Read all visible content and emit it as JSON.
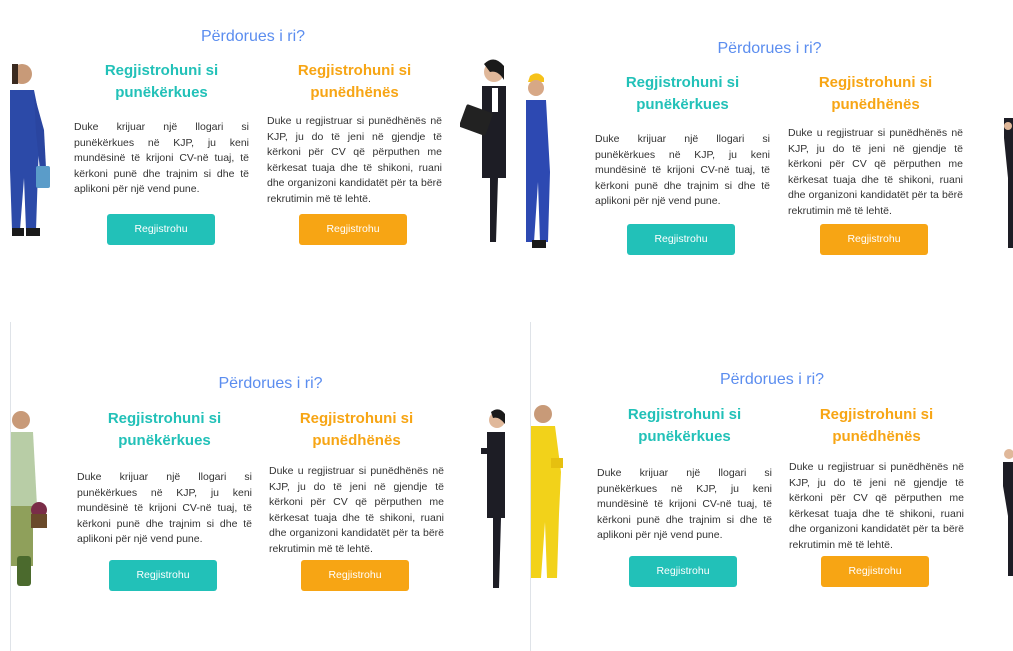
{
  "colors": {
    "title": "#5b8def",
    "jobseeker": "#22c1b8",
    "employer": "#f7a514",
    "text": "#333333"
  },
  "panels": [
    {
      "title": "Përdorues i ri?",
      "jobseeker": {
        "heading_line1": "Regjistrohuni si",
        "heading_line2": "punëkërkues",
        "description": "Duke krijuar një llogari si punëkërkues në KJP, ju keni mundësinë të krijoni CV-në tuaj, të kërkoni punë dhe trajnim si dhe të aplikoni për një vend pune.",
        "button": "Regjistrohu"
      },
      "employer": {
        "heading_line1": "Regjistrohuni si",
        "heading_line2": "punëdhënës",
        "description": "Duke u regjistruar si punëdhënës në KJP, ju do të jeni në gjendje të kërkoni për CV që përputhen me kërkesat tuaja dhe të shikoni, ruani dhe organizoni kandidatët për ta bërë rekrutimin më të lehtë.",
        "button": "Regjistrohu"
      }
    },
    {
      "title": "Përdorues i ri?",
      "jobseeker": {
        "heading_line1": "Regjistrohuni si",
        "heading_line2": "punëkërkues",
        "description": "Duke krijuar një llogari si punëkërkues në KJP, ju keni mundësinë të krijoni CV-në tuaj, të kërkoni punë dhe trajnim si dhe të aplikoni për një vend pune.",
        "button": "Regjistrohu"
      },
      "employer": {
        "heading_line1": "Regjistrohuni si",
        "heading_line2": "punëdhënës",
        "description": "Duke u regjistruar si punëdhënës në KJP, ju do të jeni në gjendje të kërkoni për CV që përputhen me kërkesat tuaja dhe të shikoni, ruani dhe organizoni kandidatët për ta bërë rekrutimin më të lehtë.",
        "button": "Regjistrohu"
      }
    },
    {
      "title": "Përdorues i ri?",
      "jobseeker": {
        "heading_line1": "Regjistrohuni si",
        "heading_line2": "punëkërkues",
        "description": "Duke krijuar një llogari si punëkërkues në KJP, ju keni mundësinë të krijoni CV-në tuaj, të kërkoni punë dhe trajnim si dhe të aplikoni për një vend pune.",
        "button": "Regjistrohu"
      },
      "employer": {
        "heading_line1": "Regjistrohuni si",
        "heading_line2": "punëdhënës",
        "description": "Duke u regjistruar si punëdhënës në KJP, ju do të jeni në gjendje të kërkoni për CV që përputhen me kërkesat tuaja dhe të shikoni, ruani dhe organizoni kandidatët për ta bërë rekrutimin më të lehtë.",
        "button": "Regjistrohu"
      }
    },
    {
      "title": "Përdorues i ri?",
      "jobseeker": {
        "heading_line1": "Regjistrohuni si",
        "heading_line2": "punëkërkues",
        "description": "Duke krijuar një llogari si punëkërkues në KJP, ju keni mundësinë të krijoni CV-në tuaj, të kërkoni punë dhe trajnim si dhe të aplikoni për një vend pune.",
        "button": "Regjistrohu"
      },
      "employer": {
        "heading_line1": "Regjistrohuni si",
        "heading_line2": "punëdhënës",
        "description": "Duke u regjistruar si punëdhënës në KJP, ju do të jeni në gjendje të kërkoni për CV që përputhen me kërkesat tuaja dhe të shikoni, ruani dhe organizoni kandidatët për ta bërë rekrutimin më të lehtë.",
        "button": "Regjistrohu"
      }
    }
  ]
}
